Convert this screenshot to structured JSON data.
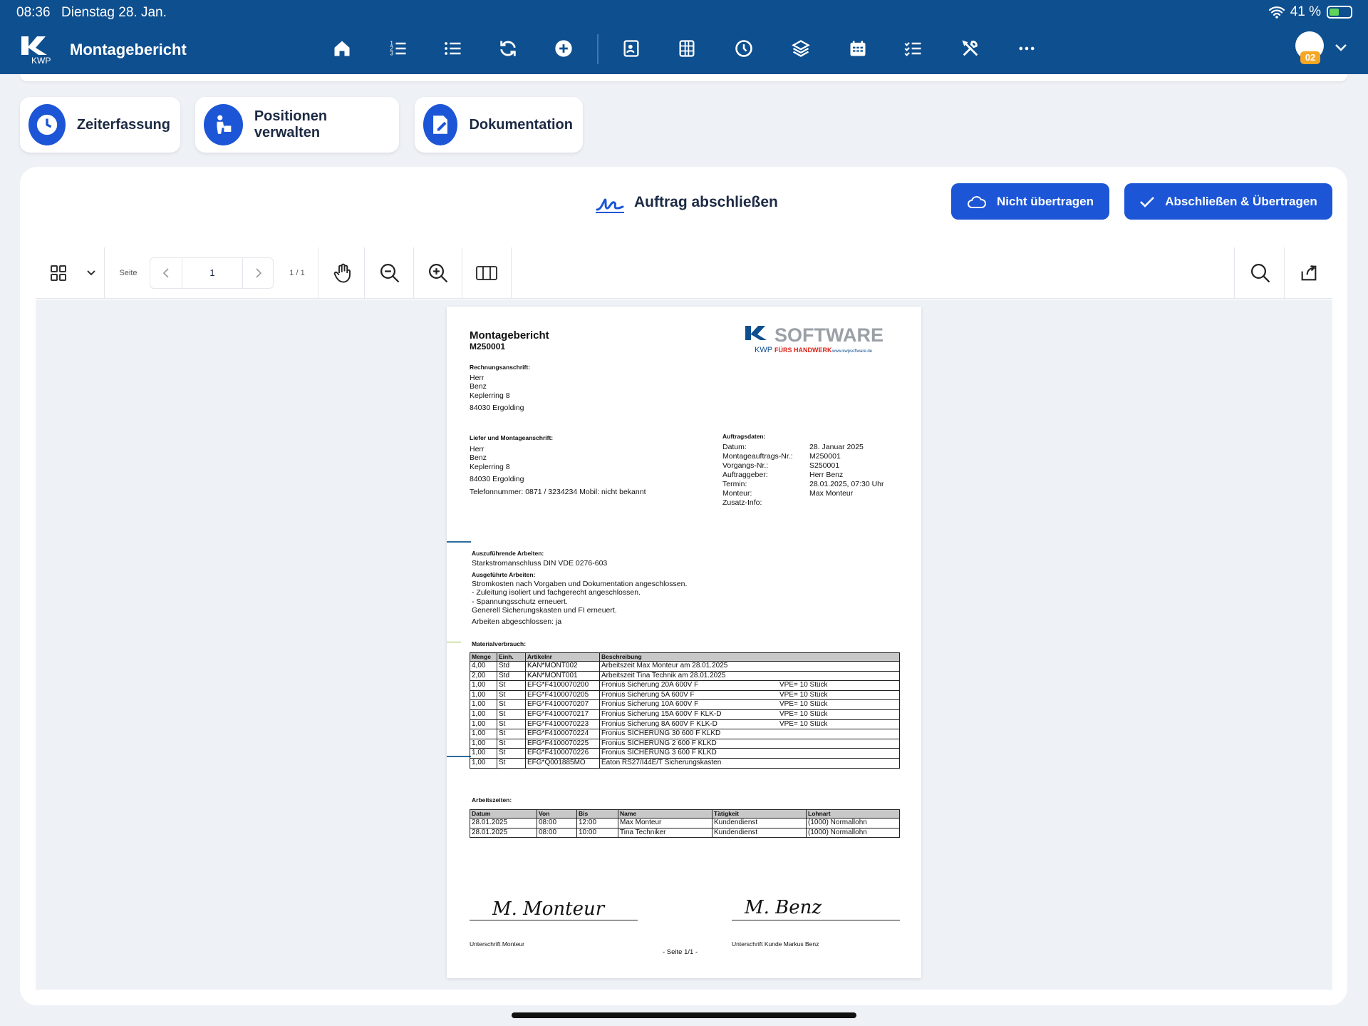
{
  "status_bar": {
    "time": "08:36",
    "date": "Dienstag 28. Jan.",
    "battery": "41 %"
  },
  "app": {
    "title": "Montagebericht",
    "logo_text": "KWP",
    "user_badge": "02"
  },
  "toolbar_icons": [
    "home-icon",
    "ordered-list-icon",
    "list-icon",
    "refresh-icon",
    "add-circle-icon",
    "contact-card-icon",
    "grid-icon",
    "clock-icon",
    "layers-icon",
    "calendar-icon",
    "checklist-icon",
    "tools-icon",
    "more-icon"
  ],
  "quick_actions": [
    {
      "label": "Zeiterfassung",
      "icon": "clock-icon"
    },
    {
      "label": "Positionen verwalten",
      "icon": "worker-icon"
    },
    {
      "label": "Dokumentation",
      "icon": "document-edit-icon"
    }
  ],
  "complete": {
    "title": "Auftrag abschließen",
    "btn_no_transfer": "Nicht übertragen",
    "btn_complete": "Abschließen & Übertragen"
  },
  "pdf_toolbar": {
    "page_label": "Seite",
    "page_value": "1",
    "page_count": "1 / 1"
  },
  "doc": {
    "title": "Montagebericht",
    "number": "M250001",
    "brand": {
      "name": "SOFTWARE",
      "tagline": "FÜRS HANDWERK",
      "url": "www.kwpsoftware.de"
    },
    "billing_label": "Rechnungsanschrift:",
    "billing": [
      "Herr",
      "Benz",
      "Keplerring 8",
      "84030 Ergolding"
    ],
    "delivery_label": "Liefer und Montageanschrift:",
    "delivery": [
      "Herr",
      "Benz",
      "Keplerring 8",
      "84030 Ergolding"
    ],
    "phone": "Telefonnummer: 0871 / 3234234 Mobil: nicht bekannt",
    "order_label": "Auftragsdaten:",
    "order_keys": [
      "Datum:",
      "Montageauftrags-Nr.:",
      "Vorgangs-Nr.:",
      "Auftraggeber:",
      "Termin:",
      "Monteur:",
      "Zusatz-Info:"
    ],
    "order_vals": [
      "28. Januar 2025",
      "M250001",
      "S250001",
      "Herr Benz",
      "28.01.2025, 07:30 Uhr",
      "Max Monteur",
      ""
    ],
    "work_todo_label": "Auszuführende Arbeiten:",
    "work_todo": "Starkstromanschluss DIN VDE 0276-603",
    "work_done_label": "Ausgeführte Arbeiten:",
    "work_done": [
      "Stromkosten nach Vorgaben und Dokumentation angeschlossen.",
      "- Zuleitung isoliert und fachgerecht angeschlossen.",
      "- Spannungsschutz erneuert.",
      "Generell Sicherungskasten und FI erneuert."
    ],
    "work_finished": "Arbeiten abgeschlossen: ja",
    "material_label": "Materialverbrauch:",
    "material_headers": [
      "Menge",
      "Einh.",
      "Artikelnr",
      "Beschreibung"
    ],
    "material_rows": [
      [
        "4,00",
        "Std",
        "KAN*MONT002",
        "Arbeitszeit Max Monteur am 28.01.2025",
        ""
      ],
      [
        "2,00",
        "Std",
        "KAN*MONT001",
        "Arbeitszeit Tina Technik am 28.01.2025",
        ""
      ],
      [
        "1,00",
        "St",
        "EFG*F4100070200",
        "Fronius Sicherung 20A 600V F",
        "VPE= 10 Stück"
      ],
      [
        "1,00",
        "St",
        "EFG*F4100070205",
        "Fronius Sicherung 5A 600V F",
        "VPE= 10 Stück"
      ],
      [
        "1,00",
        "St",
        "EFG*F4100070207",
        "Fronius Sicherung 10A 600V F",
        "VPE= 10 Stück"
      ],
      [
        "1,00",
        "St",
        "EFG*F4100070217",
        "Fronius Sicherung 15A 600V F KLK-D",
        "VPE= 10 Stück"
      ],
      [
        "1,00",
        "St",
        "EFG*F4100070223",
        "Fronius Sicherung 8A 600V F KLK-D",
        "VPE= 10 Stück"
      ],
      [
        "1,00",
        "St",
        "EFG*F4100070224",
        "Fronius SICHERUNG 30 600 F KLKD",
        ""
      ],
      [
        "1,00",
        "St",
        "EFG*F4100070225",
        "Fronius SICHERUNG  2 600 F KLKD",
        ""
      ],
      [
        "1,00",
        "St",
        "EFG*F4100070226",
        "Fronius SICHERUNG  3 600 F KLKD",
        ""
      ],
      [
        "1,00",
        "St",
        "EFG*Q001885MO",
        "Eaton RS27/I44E/T Sicherungskasten",
        ""
      ]
    ],
    "times_label": "Arbeitszeiten:",
    "times_headers": [
      "Datum",
      "Von",
      "Bis",
      "Name",
      "Tätigkeit",
      "Lohnart"
    ],
    "times_rows": [
      [
        "28.01.2025",
        "08:00",
        "12:00",
        "Max Monteur",
        "Kundendienst",
        "(1000) Normallohn"
      ],
      [
        "28.01.2025",
        "08:00",
        "10:00",
        "Tina Techniker",
        "Kundendienst",
        "(1000) Normallohn"
      ]
    ],
    "sig_left_text": "M. Monteur",
    "sig_right_text": "M. Benz",
    "sig_left": "Unterschrift Monteur",
    "sig_right": "Unterschrift Kunde Markus Benz",
    "footer": "- Seite 1/1 -"
  },
  "colors": {
    "brand_blue": "#0e4f8f",
    "accent": "#1c56d6",
    "background": "#eef1f6"
  }
}
